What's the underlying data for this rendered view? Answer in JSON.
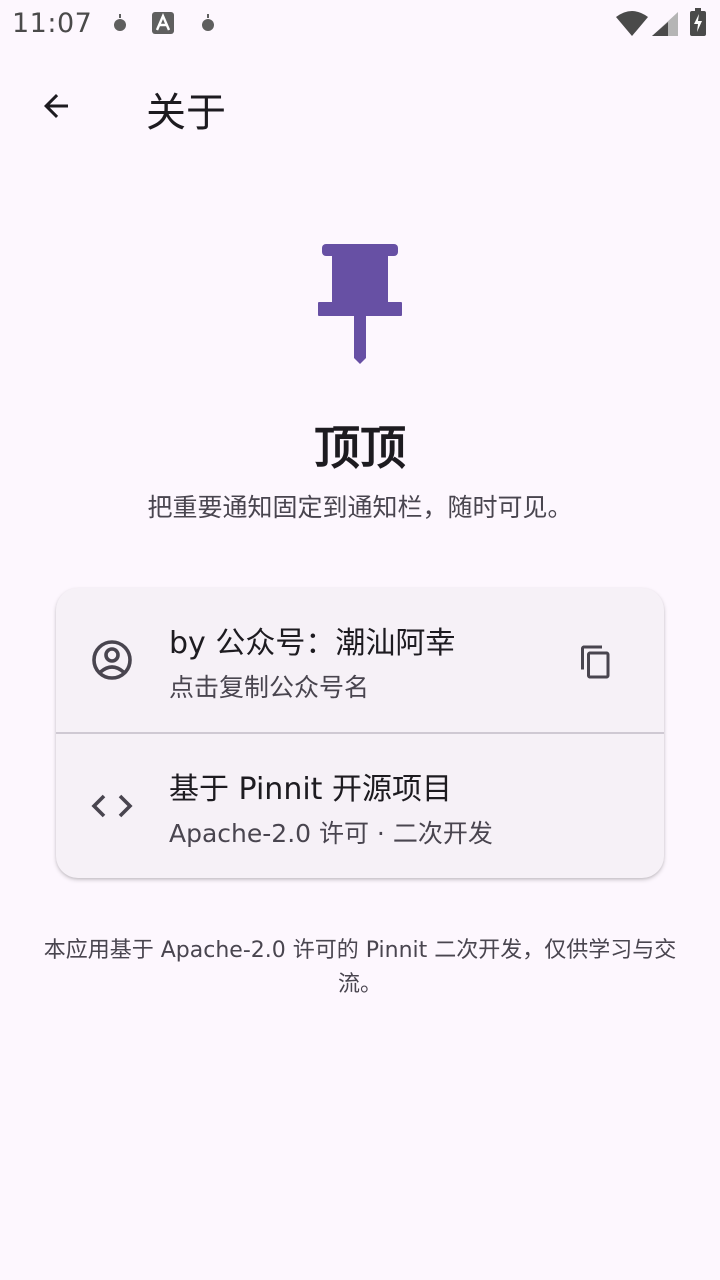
{
  "status_bar": {
    "time": "11:07",
    "icons": [
      "notification-dot-icon",
      "accessibility-a-icon",
      "notification-dot-icon",
      "wifi-icon",
      "cell-signal-icon",
      "battery-charging-icon"
    ]
  },
  "app_bar": {
    "title": "关于",
    "back_icon": "arrow-back-icon"
  },
  "hero": {
    "icon": "push-pin-icon",
    "app_name": "顶顶",
    "tagline": "把重要通知固定到通知栏，随时可见。"
  },
  "card": {
    "rows": [
      {
        "icon": "account-circle-icon",
        "title": "by 公众号：潮汕阿幸",
        "subtitle": "点击复制公众号名",
        "trailing_icon": "copy-icon"
      },
      {
        "icon": "code-icon",
        "title": "基于 Pinnit 开源项目",
        "subtitle": "Apache-2.0 许可 · 二次开发"
      }
    ]
  },
  "footer": {
    "note": "本应用基于 Apache-2.0 许可的 Pinnit 二次开发，仅供学习与交流。"
  },
  "colors": {
    "background": "#fdf7fe",
    "accent": "#6750a4",
    "card": "#f6f1f7",
    "text_primary": "#1d1b20",
    "text_secondary": "#49454f"
  }
}
